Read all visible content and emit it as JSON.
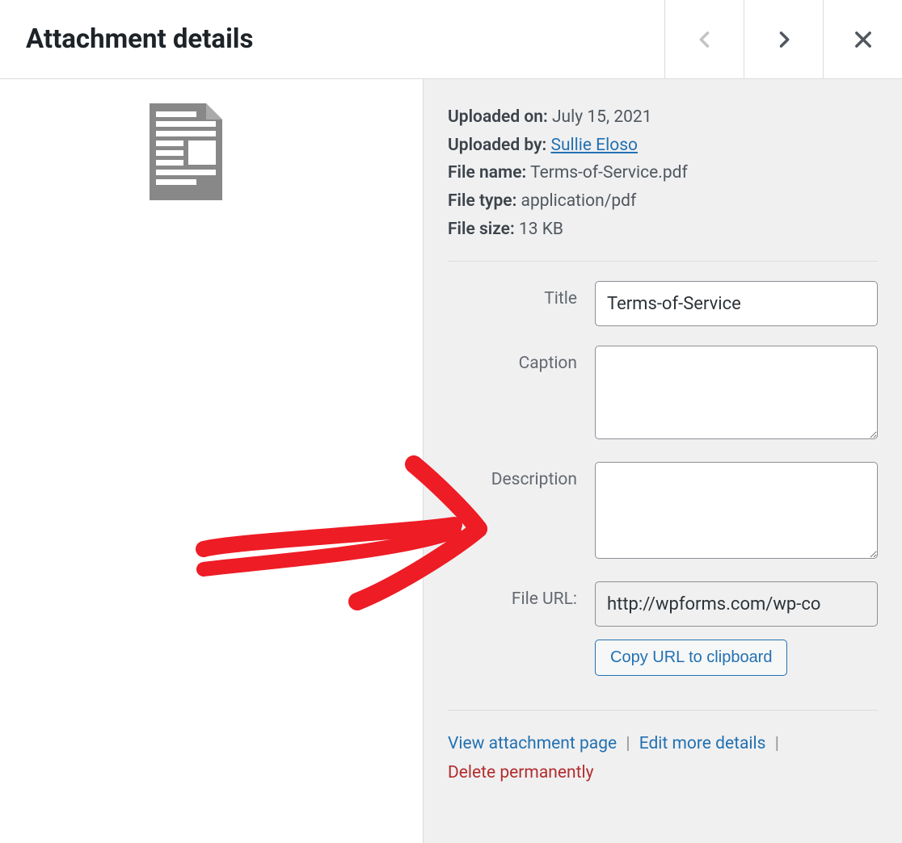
{
  "header": {
    "title": "Attachment details"
  },
  "meta": {
    "uploaded_on_label": "Uploaded on:",
    "uploaded_on_value": "July 15, 2021",
    "uploaded_by_label": "Uploaded by:",
    "uploaded_by_value": "Sullie Eloso",
    "file_name_label": "File name:",
    "file_name_value": "Terms-of-Service.pdf",
    "file_type_label": "File type:",
    "file_type_value": "application/pdf",
    "file_size_label": "File size:",
    "file_size_value": "13 KB"
  },
  "form": {
    "title_label": "Title",
    "title_value": "Terms-of-Service",
    "caption_label": "Caption",
    "caption_value": "",
    "description_label": "Description",
    "description_value": "",
    "file_url_label": "File URL:",
    "file_url_value": "http://wpforms.com/wp-co",
    "copy_url_label": "Copy URL to clipboard"
  },
  "actions": {
    "view_page": "View attachment page",
    "edit_more": "Edit more details",
    "delete": "Delete permanently"
  }
}
